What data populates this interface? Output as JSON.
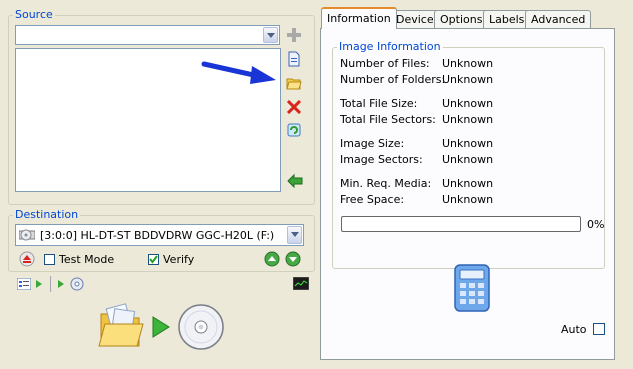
{
  "source": {
    "title": "Source",
    "file_combo_value": ""
  },
  "destination": {
    "title": "Destination",
    "drive": "[3:0:0] HL-DT-ST BDDVDRW GGC-H20L (F:)",
    "test_mode_label": "Test Mode",
    "test_mode_checked": false,
    "verify_label": "Verify",
    "verify_checked": true
  },
  "tabs": [
    "Information",
    "Device",
    "Options",
    "Labels",
    "Advanced"
  ],
  "active_tab": "Information",
  "information": {
    "group_title": "Image Information",
    "rows": [
      {
        "label": "Number of Files:",
        "value": "Unknown"
      },
      {
        "label": "Number of Folders:",
        "value": "Unknown"
      },
      {
        "label": "Total File Size:",
        "value": "Unknown"
      },
      {
        "label": "Total File Sectors:",
        "value": "Unknown"
      },
      {
        "label": "Image Size:",
        "value": "Unknown"
      },
      {
        "label": "Image Sectors:",
        "value": "Unknown"
      },
      {
        "label": "Min. Req. Media:",
        "value": "Unknown"
      },
      {
        "label": "Free Space:",
        "value": "Unknown"
      }
    ],
    "progress_text": "0%",
    "progress_fraction": 0,
    "auto_label": "Auto",
    "auto_checked": false
  },
  "colors": {
    "group_title": "#0046d5",
    "arrow": "#1a35d6",
    "tab_active_accent": "#e68b2c"
  },
  "icons": {
    "source_side": [
      "add-icon",
      "add-file-icon",
      "add-folder-icon",
      "remove-icon",
      "reload-icon",
      "back-icon"
    ],
    "destination": [
      "drive-icon",
      "eject-icon",
      "speed-up-icon",
      "speed-down-icon"
    ],
    "toolbar": [
      "file-list-icon",
      "play-icon",
      "play-icon",
      "disc-info-icon",
      "log-icon"
    ],
    "main": [
      "build-folder-icon",
      "arrow-right-icon",
      "disc-icon",
      "calculator-icon"
    ]
  }
}
